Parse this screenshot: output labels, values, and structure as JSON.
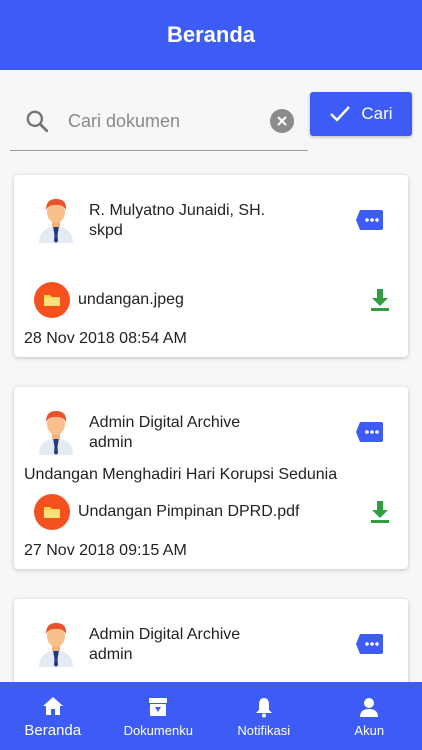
{
  "header": {
    "title": "Beranda"
  },
  "search": {
    "placeholder": "Cari dokumen",
    "value": "",
    "button_label": "Cari"
  },
  "cards": [
    {
      "author": "R. Mulyatno Junaidi, SH.",
      "role": "skpd",
      "description": "",
      "file_name": "undangan.jpeg",
      "date": "28 Nov 2018 08:54 AM"
    },
    {
      "author": "Admin Digital Archive",
      "role": "admin",
      "description": "Undangan Menghadiri Hari Korupsi Sedunia",
      "file_name": "Undangan Pimpinan DPRD.pdf",
      "date": "27 Nov 2018 09:15 AM"
    },
    {
      "author": "Admin Digital Archive",
      "role": "admin",
      "description": "",
      "file_name": "",
      "date": ""
    }
  ],
  "nav": {
    "items": [
      {
        "label": "Beranda",
        "icon": "home-icon",
        "active": true
      },
      {
        "label": "Dokumenku",
        "icon": "archive-icon",
        "active": false
      },
      {
        "label": "Notifikasi",
        "icon": "bell-icon",
        "active": false
      },
      {
        "label": "Akun",
        "icon": "person-icon",
        "active": false
      }
    ]
  },
  "colors": {
    "primary": "#3d5cf5",
    "download": "#2e9e3e",
    "file_icon_bg": "#f4511e"
  }
}
